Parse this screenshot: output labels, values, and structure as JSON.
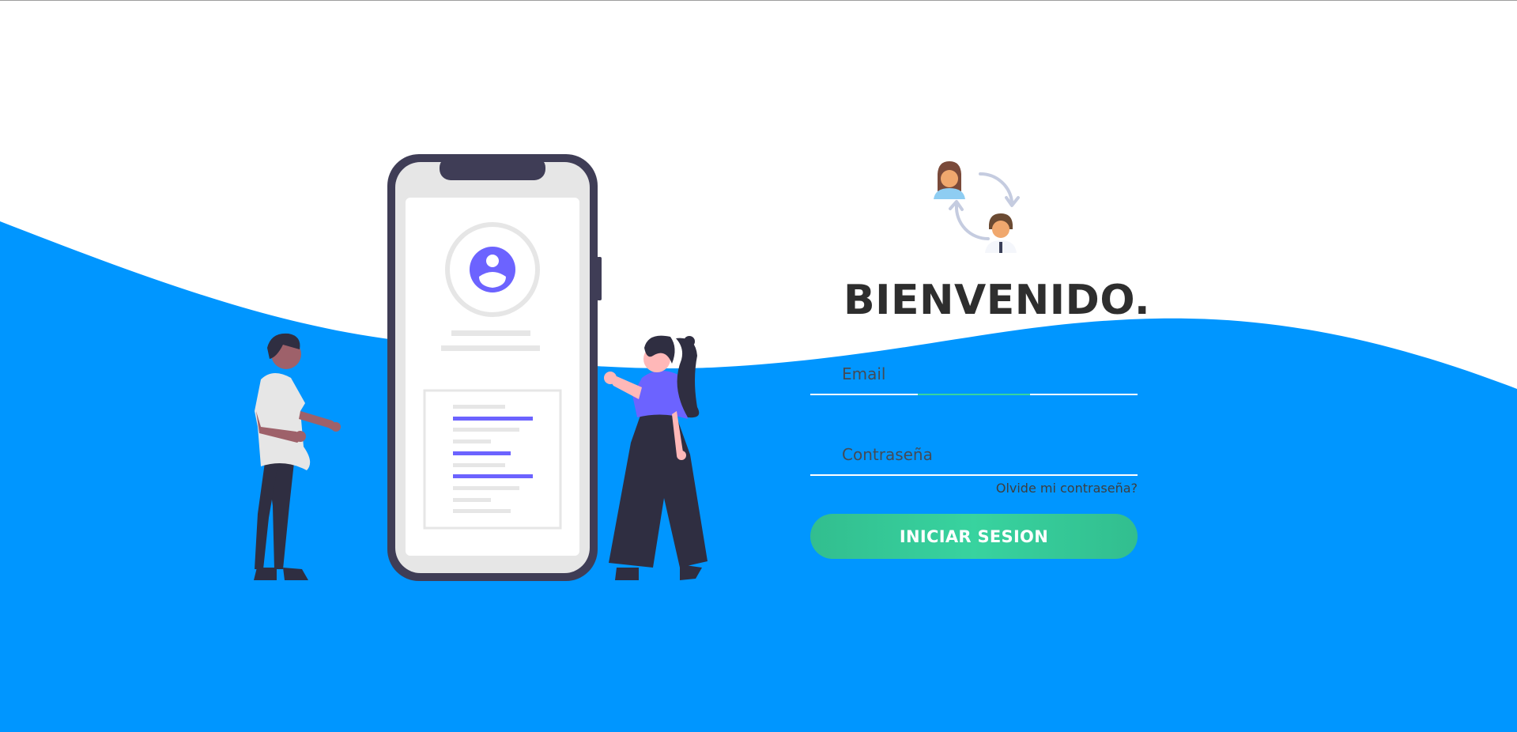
{
  "colors": {
    "background_wave": "#0096ff",
    "accent": "#38d39f",
    "illustration_purple": "#6c63ff",
    "illustration_dark": "#3f3d56",
    "title_text": "#2e2e2e"
  },
  "header": {
    "avatar_icon": "user-exchange-icon",
    "title": "BIENVENIDO."
  },
  "form": {
    "email_placeholder": "Email",
    "email_value": "",
    "password_placeholder": "Contraseña",
    "password_value": "",
    "forgot_password": "Olvide mi contraseña?",
    "submit_label": "INICIAR SESION"
  }
}
